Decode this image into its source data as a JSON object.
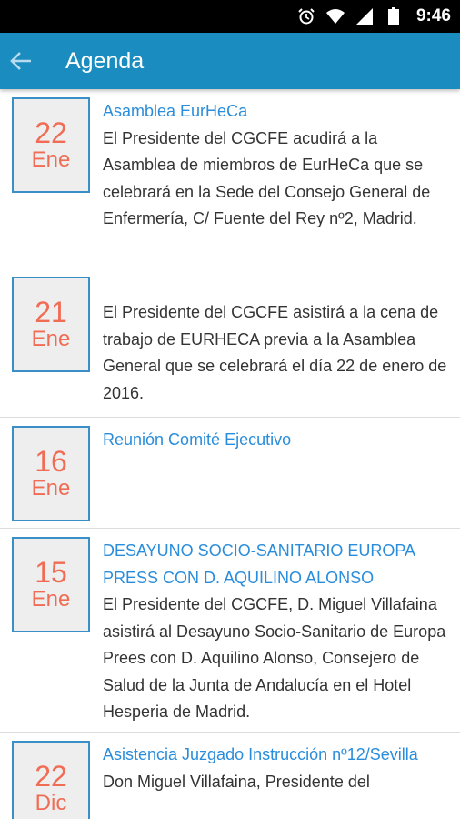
{
  "status_bar": {
    "time": "9:46",
    "icons": [
      "alarm-icon",
      "wifi-icon",
      "signal-icon",
      "battery-icon"
    ]
  },
  "app_bar": {
    "title": "Agenda",
    "back_icon": "arrow-left-icon"
  },
  "colors": {
    "app_bar": "#1a8cbf",
    "title_link": "#2a8ddb",
    "date_text": "#f06c55",
    "date_border": "#3a8fc7"
  },
  "events": [
    {
      "day": "22",
      "month": "Ene",
      "title": "Asamblea EurHeCa",
      "description": "El Presidente del CGCFE acudirá a la Asamblea de miembros de EurHeCa que se celebrará en la Sede del Consejo General de Enfermería, C/ Fuente del Rey nº2, Madrid."
    },
    {
      "day": "21",
      "month": "Ene",
      "title": "",
      "description": "El Presidente del CGCFE asistirá a la cena de trabajo de EURHECA previa a la Asamblea General que se celebrará el día 22 de enero de 2016."
    },
    {
      "day": "16",
      "month": "Ene",
      "title": "Reunión Comité Ejecutivo",
      "description": ""
    },
    {
      "day": "15",
      "month": "Ene",
      "title": "DESAYUNO SOCIO-SANITARIO EUROPA PRESS CON D. AQUILINO ALONSO",
      "description": "El Presidente del CGCFE, D. Miguel Villafaina asistirá al Desayuno Socio-Sanitario de Europa Prees con D. Aquilino Alonso, Consejero de Salud de la Junta de Andalucía en el Hotel Hesperia de Madrid."
    },
    {
      "day": "22",
      "month": "Dic",
      "title": "Asistencia Juzgado Instrucción nº12/Sevilla",
      "description": "Don Miguel Villafaina, Presidente del"
    }
  ]
}
